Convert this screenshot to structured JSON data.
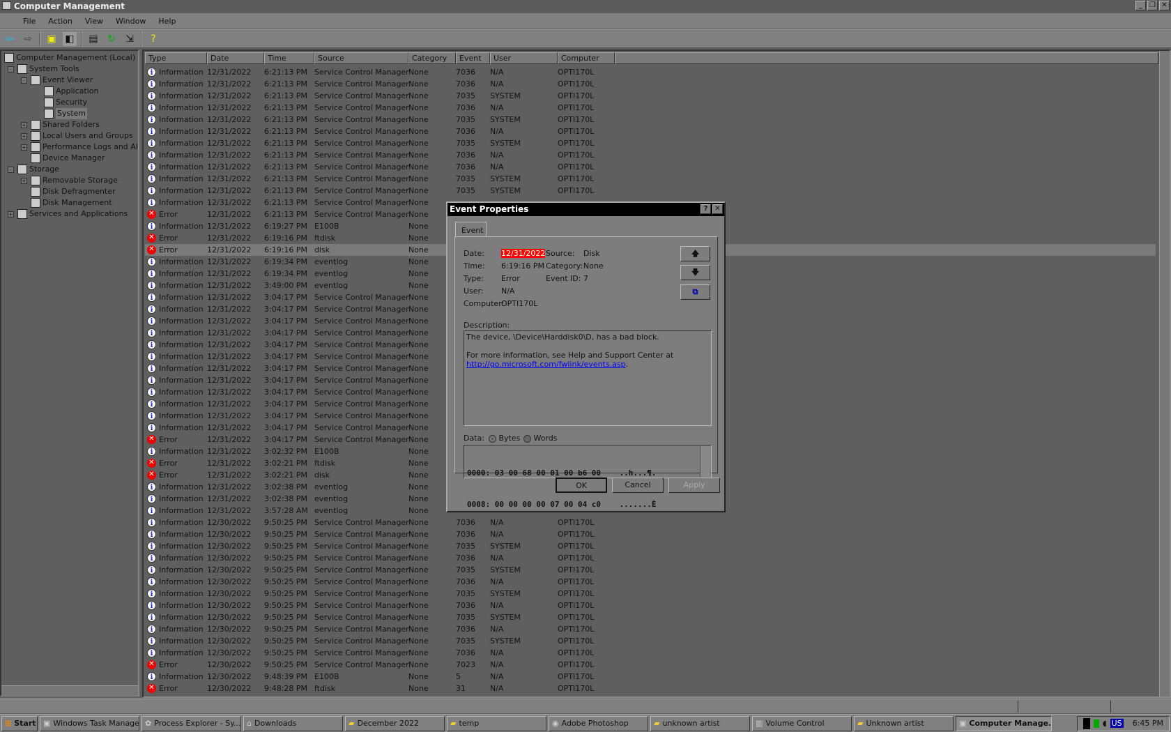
{
  "window": {
    "title": "Computer Management"
  },
  "menu": [
    "File",
    "Action",
    "View",
    "Window",
    "Help"
  ],
  "tree": [
    {
      "label": "Computer Management (Local)",
      "level": 0,
      "pm": ""
    },
    {
      "label": "System Tools",
      "level": 1,
      "pm": "−"
    },
    {
      "label": "Event Viewer",
      "level": 2,
      "pm": "−"
    },
    {
      "label": "Application",
      "level": 3,
      "pm": ""
    },
    {
      "label": "Security",
      "level": 3,
      "pm": ""
    },
    {
      "label": "System",
      "level": 3,
      "pm": "",
      "selected": true
    },
    {
      "label": "Shared Folders",
      "level": 2,
      "pm": "+"
    },
    {
      "label": "Local Users and Groups",
      "level": 2,
      "pm": "+"
    },
    {
      "label": "Performance Logs and Alerts",
      "level": 2,
      "pm": "+"
    },
    {
      "label": "Device Manager",
      "level": 2,
      "pm": ""
    },
    {
      "label": "Storage",
      "level": 1,
      "pm": "−"
    },
    {
      "label": "Removable Storage",
      "level": 2,
      "pm": "+"
    },
    {
      "label": "Disk Defragmenter",
      "level": 2,
      "pm": ""
    },
    {
      "label": "Disk Management",
      "level": 2,
      "pm": ""
    },
    {
      "label": "Services and Applications",
      "level": 1,
      "pm": "+"
    }
  ],
  "columns": [
    "Type",
    "Date",
    "Time",
    "Source",
    "Category",
    "Event",
    "User",
    "Computer"
  ],
  "rows": [
    [
      "Information",
      "12/31/2022",
      "6:21:13 PM",
      "Service Control Manager",
      "None",
      "7036",
      "N/A",
      "OPTI170L"
    ],
    [
      "Information",
      "12/31/2022",
      "6:21:13 PM",
      "Service Control Manager",
      "None",
      "7036",
      "N/A",
      "OPTI170L"
    ],
    [
      "Information",
      "12/31/2022",
      "6:21:13 PM",
      "Service Control Manager",
      "None",
      "7035",
      "SYSTEM",
      "OPTI170L"
    ],
    [
      "Information",
      "12/31/2022",
      "6:21:13 PM",
      "Service Control Manager",
      "None",
      "7036",
      "N/A",
      "OPTI170L"
    ],
    [
      "Information",
      "12/31/2022",
      "6:21:13 PM",
      "Service Control Manager",
      "None",
      "7035",
      "SYSTEM",
      "OPTI170L"
    ],
    [
      "Information",
      "12/31/2022",
      "6:21:13 PM",
      "Service Control Manager",
      "None",
      "7036",
      "N/A",
      "OPTI170L"
    ],
    [
      "Information",
      "12/31/2022",
      "6:21:13 PM",
      "Service Control Manager",
      "None",
      "7035",
      "SYSTEM",
      "OPTI170L"
    ],
    [
      "Information",
      "12/31/2022",
      "6:21:13 PM",
      "Service Control Manager",
      "None",
      "7036",
      "N/A",
      "OPTI170L"
    ],
    [
      "Information",
      "12/31/2022",
      "6:21:13 PM",
      "Service Control Manager",
      "None",
      "7036",
      "N/A",
      "OPTI170L"
    ],
    [
      "Information",
      "12/31/2022",
      "6:21:13 PM",
      "Service Control Manager",
      "None",
      "7035",
      "SYSTEM",
      "OPTI170L"
    ],
    [
      "Information",
      "12/31/2022",
      "6:21:13 PM",
      "Service Control Manager",
      "None",
      "7035",
      "SYSTEM",
      "OPTI170L"
    ],
    [
      "Information",
      "12/31/2022",
      "6:21:13 PM",
      "Service Control Manager",
      "None",
      "",
      "",
      ""
    ],
    [
      "Error",
      "12/31/2022",
      "6:21:13 PM",
      "Service Control Manager",
      "None",
      "",
      "",
      ""
    ],
    [
      "Information",
      "12/31/2022",
      "6:19:27 PM",
      "E100B",
      "None",
      "",
      "",
      ""
    ],
    [
      "Error",
      "12/31/2022",
      "6:19:16 PM",
      "ftdisk",
      "None",
      "",
      "",
      ""
    ],
    [
      "Error",
      "12/31/2022",
      "6:19:16 PM",
      "disk",
      "None",
      "",
      "",
      ""
    ],
    [
      "Information",
      "12/31/2022",
      "6:19:34 PM",
      "eventlog",
      "None",
      "",
      "",
      ""
    ],
    [
      "Information",
      "12/31/2022",
      "6:19:34 PM",
      "eventlog",
      "None",
      "",
      "",
      ""
    ],
    [
      "Information",
      "12/31/2022",
      "3:49:00 PM",
      "eventlog",
      "None",
      "",
      "",
      ""
    ],
    [
      "Information",
      "12/31/2022",
      "3:04:17 PM",
      "Service Control Manager",
      "None",
      "",
      "",
      ""
    ],
    [
      "Information",
      "12/31/2022",
      "3:04:17 PM",
      "Service Control Manager",
      "None",
      "",
      "",
      ""
    ],
    [
      "Information",
      "12/31/2022",
      "3:04:17 PM",
      "Service Control Manager",
      "None",
      "",
      "",
      ""
    ],
    [
      "Information",
      "12/31/2022",
      "3:04:17 PM",
      "Service Control Manager",
      "None",
      "",
      "",
      ""
    ],
    [
      "Information",
      "12/31/2022",
      "3:04:17 PM",
      "Service Control Manager",
      "None",
      "",
      "",
      ""
    ],
    [
      "Information",
      "12/31/2022",
      "3:04:17 PM",
      "Service Control Manager",
      "None",
      "",
      "",
      ""
    ],
    [
      "Information",
      "12/31/2022",
      "3:04:17 PM",
      "Service Control Manager",
      "None",
      "",
      "",
      ""
    ],
    [
      "Information",
      "12/31/2022",
      "3:04:17 PM",
      "Service Control Manager",
      "None",
      "",
      "",
      ""
    ],
    [
      "Information",
      "12/31/2022",
      "3:04:17 PM",
      "Service Control Manager",
      "None",
      "",
      "",
      ""
    ],
    [
      "Information",
      "12/31/2022",
      "3:04:17 PM",
      "Service Control Manager",
      "None",
      "",
      "",
      ""
    ],
    [
      "Information",
      "12/31/2022",
      "3:04:17 PM",
      "Service Control Manager",
      "None",
      "",
      "",
      ""
    ],
    [
      "Information",
      "12/31/2022",
      "3:04:17 PM",
      "Service Control Manager",
      "None",
      "",
      "",
      ""
    ],
    [
      "Error",
      "12/31/2022",
      "3:04:17 PM",
      "Service Control Manager",
      "None",
      "",
      "",
      ""
    ],
    [
      "Information",
      "12/31/2022",
      "3:02:32 PM",
      "E100B",
      "None",
      "",
      "",
      ""
    ],
    [
      "Error",
      "12/31/2022",
      "3:02:21 PM",
      "ftdisk",
      "None",
      "",
      "",
      ""
    ],
    [
      "Error",
      "12/31/2022",
      "3:02:21 PM",
      "disk",
      "None",
      "",
      "",
      ""
    ],
    [
      "Information",
      "12/31/2022",
      "3:02:38 PM",
      "eventlog",
      "None",
      "",
      "",
      ""
    ],
    [
      "Information",
      "12/31/2022",
      "3:02:38 PM",
      "eventlog",
      "None",
      "",
      "",
      ""
    ],
    [
      "Information",
      "12/31/2022",
      "3:57:28 AM",
      "eventlog",
      "None",
      "",
      "",
      ""
    ],
    [
      "Information",
      "12/30/2022",
      "9:50:25 PM",
      "Service Control Manager",
      "None",
      "7036",
      "N/A",
      "OPTI170L"
    ],
    [
      "Information",
      "12/30/2022",
      "9:50:25 PM",
      "Service Control Manager",
      "None",
      "7036",
      "N/A",
      "OPTI170L"
    ],
    [
      "Information",
      "12/30/2022",
      "9:50:25 PM",
      "Service Control Manager",
      "None",
      "7035",
      "SYSTEM",
      "OPTI170L"
    ],
    [
      "Information",
      "12/30/2022",
      "9:50:25 PM",
      "Service Control Manager",
      "None",
      "7036",
      "N/A",
      "OPTI170L"
    ],
    [
      "Information",
      "12/30/2022",
      "9:50:25 PM",
      "Service Control Manager",
      "None",
      "7035",
      "SYSTEM",
      "OPTI170L"
    ],
    [
      "Information",
      "12/30/2022",
      "9:50:25 PM",
      "Service Control Manager",
      "None",
      "7036",
      "N/A",
      "OPTI170L"
    ],
    [
      "Information",
      "12/30/2022",
      "9:50:25 PM",
      "Service Control Manager",
      "None",
      "7035",
      "SYSTEM",
      "OPTI170L"
    ],
    [
      "Information",
      "12/30/2022",
      "9:50:25 PM",
      "Service Control Manager",
      "None",
      "7036",
      "N/A",
      "OPTI170L"
    ],
    [
      "Information",
      "12/30/2022",
      "9:50:25 PM",
      "Service Control Manager",
      "None",
      "7035",
      "SYSTEM",
      "OPTI170L"
    ],
    [
      "Information",
      "12/30/2022",
      "9:50:25 PM",
      "Service Control Manager",
      "None",
      "7036",
      "N/A",
      "OPTI170L"
    ],
    [
      "Information",
      "12/30/2022",
      "9:50:25 PM",
      "Service Control Manager",
      "None",
      "7035",
      "SYSTEM",
      "OPTI170L"
    ],
    [
      "Information",
      "12/30/2022",
      "9:50:25 PM",
      "Service Control Manager",
      "None",
      "7036",
      "N/A",
      "OPTI170L"
    ],
    [
      "Error",
      "12/30/2022",
      "9:50:25 PM",
      "Service Control Manager",
      "None",
      "7023",
      "N/A",
      "OPTI170L"
    ],
    [
      "Information",
      "12/30/2022",
      "9:48:39 PM",
      "E100B",
      "None",
      "5",
      "N/A",
      "OPTI170L"
    ],
    [
      "Error",
      "12/30/2022",
      "9:48:28 PM",
      "ftdisk",
      "None",
      "31",
      "N/A",
      "OPTI170L"
    ]
  ],
  "selected_row": 15,
  "dialog": {
    "title": "Event Properties",
    "help": "?",
    "close": "✕",
    "tab": "Event",
    "date_label": "Date:",
    "date": "12/31/2022",
    "source_label": "Source:",
    "source": "Disk",
    "time_label": "Time:",
    "time": "6:19:16 PM",
    "category_label": "Category:",
    "category": "None",
    "type_label": "Type:",
    "type": "Error",
    "eventid_label": "Event ID:",
    "eventid": "7",
    "user_label": "User:",
    "user": "N/A",
    "computer_label": "Computer:",
    "computer": "OPTI170L",
    "description_label": "Description:",
    "description_line1": "The device, \\Device\\Harddisk0\\D, has a bad block.",
    "description_line2": "For more information, see Help and Support Center at",
    "description_link": "http://go.microsoft.com/fwlink/events.asp",
    "data_label": "Data:",
    "bytes_label": "Bytes",
    "words_label": "Words",
    "hex_line1": "0000: 03 00 68 00 01 00 b6 00    ..h...¶.",
    "hex_line2": "0008: 00 00 00 00 07 00 04 c0    .......Ѐ",
    "ok": "OK",
    "cancel": "Cancel",
    "apply": "Apply"
  },
  "taskbar": {
    "start": "Start",
    "items": [
      "Windows Task Manager",
      "Process Explorer - Sy...",
      "Downloads",
      "December 2022",
      "temp",
      "Adobe Photoshop",
      "unknown artist",
      "Volume Control",
      "Unknown artist",
      "Computer Manage..."
    ],
    "active_index": 9,
    "lang": "US",
    "clock": "6:45 PM"
  },
  "colors": {
    "highlight": "#ff0000",
    "link": "#0000ff"
  }
}
